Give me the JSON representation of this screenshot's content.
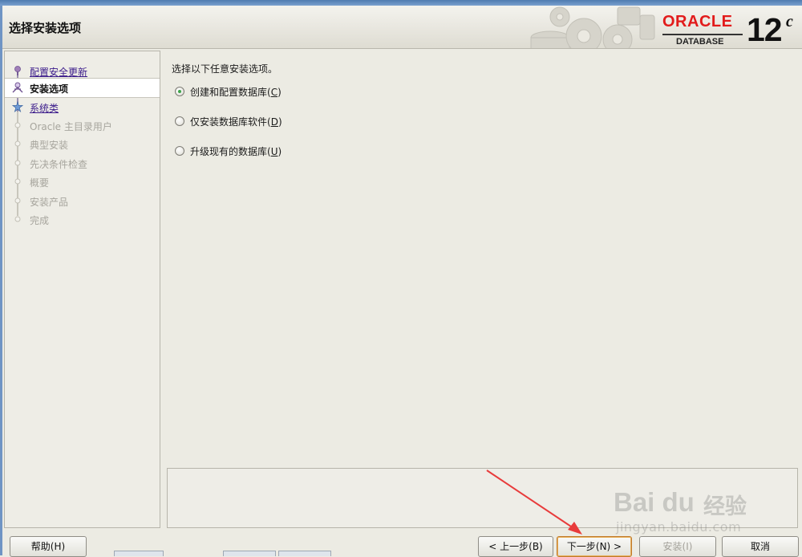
{
  "header": {
    "title": "选择安装选项",
    "brand_word": "ORACLE",
    "brand_sub": "DATABASE",
    "version_number": "12",
    "version_suffix": "c",
    "brand_color": "#e21b1b"
  },
  "steps": [
    {
      "label": "配置安全更新",
      "state": "link"
    },
    {
      "label": "安装选项",
      "state": "current"
    },
    {
      "label": "系统类",
      "state": "link"
    },
    {
      "label": "Oracle 主目录用户",
      "state": "disabled"
    },
    {
      "label": "典型安装",
      "state": "disabled"
    },
    {
      "label": "先决条件检查",
      "state": "disabled"
    },
    {
      "label": "概要",
      "state": "disabled"
    },
    {
      "label": "安装产品",
      "state": "disabled"
    },
    {
      "label": "完成",
      "state": "disabled"
    }
  ],
  "main": {
    "instruction": "选择以下任意安装选项。",
    "options": [
      {
        "text": "创建和配置数据库(",
        "key": "C",
        "suffix": ")",
        "checked": true
      },
      {
        "text": "仅安装数据库软件(",
        "key": "D",
        "suffix": ")",
        "checked": false
      },
      {
        "text": "升级现有的数据库(",
        "key": "U",
        "suffix": ")",
        "checked": false
      }
    ]
  },
  "buttons": {
    "help": "帮助(H)",
    "back": "< 上一步(B)",
    "next": "下一步(N) >",
    "install": "安装(I)",
    "cancel": "取消"
  },
  "watermark": {
    "logo_text": "Bai du",
    "cn_text": "经验",
    "url": "jingyan.baidu.com"
  },
  "colors": {
    "annotation_arrow": "#e83b3b",
    "selected_radio": "#3da44a"
  }
}
